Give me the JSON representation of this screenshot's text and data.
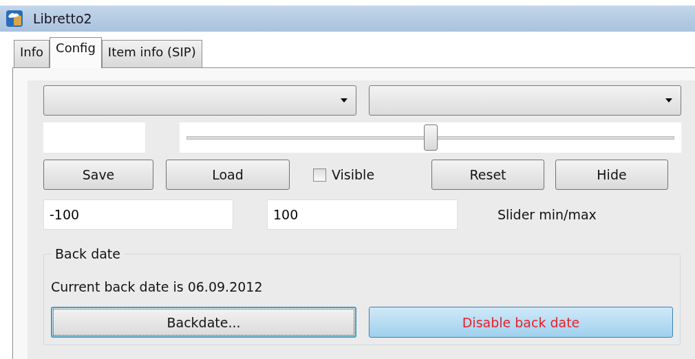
{
  "window": {
    "title": "Libretto2"
  },
  "tabs": [
    {
      "label": "Info",
      "selected": false
    },
    {
      "label": "Config",
      "selected": true
    },
    {
      "label": "Item info (SIP)",
      "selected": false
    }
  ],
  "dropdowns": [
    {
      "kind": "combo"
    },
    {
      "kind": "combo"
    }
  ],
  "slider": {
    "level": 0.5
  },
  "buttons": [
    {
      "label": "Save"
    },
    {
      "label": "Load"
    }
  ],
  "visible_checkbox": {
    "label": "Visible",
    "checked": false
  },
  "buttons_right": [
    {
      "label": "Reset"
    },
    {
      "label": "Hide"
    }
  ],
  "slider_min": {
    "value": "-100"
  },
  "slider_max": {
    "value": "100"
  },
  "slider_range_label": "Slider min/max",
  "back_date": {
    "title": "Back date",
    "text": "Current back date is 06.09.2012",
    "buttons": [
      {
        "label": "Backdate...",
        "kind": "focused"
      },
      {
        "label": "Disable back date",
        "kind": "warning"
      }
    ]
  }
}
